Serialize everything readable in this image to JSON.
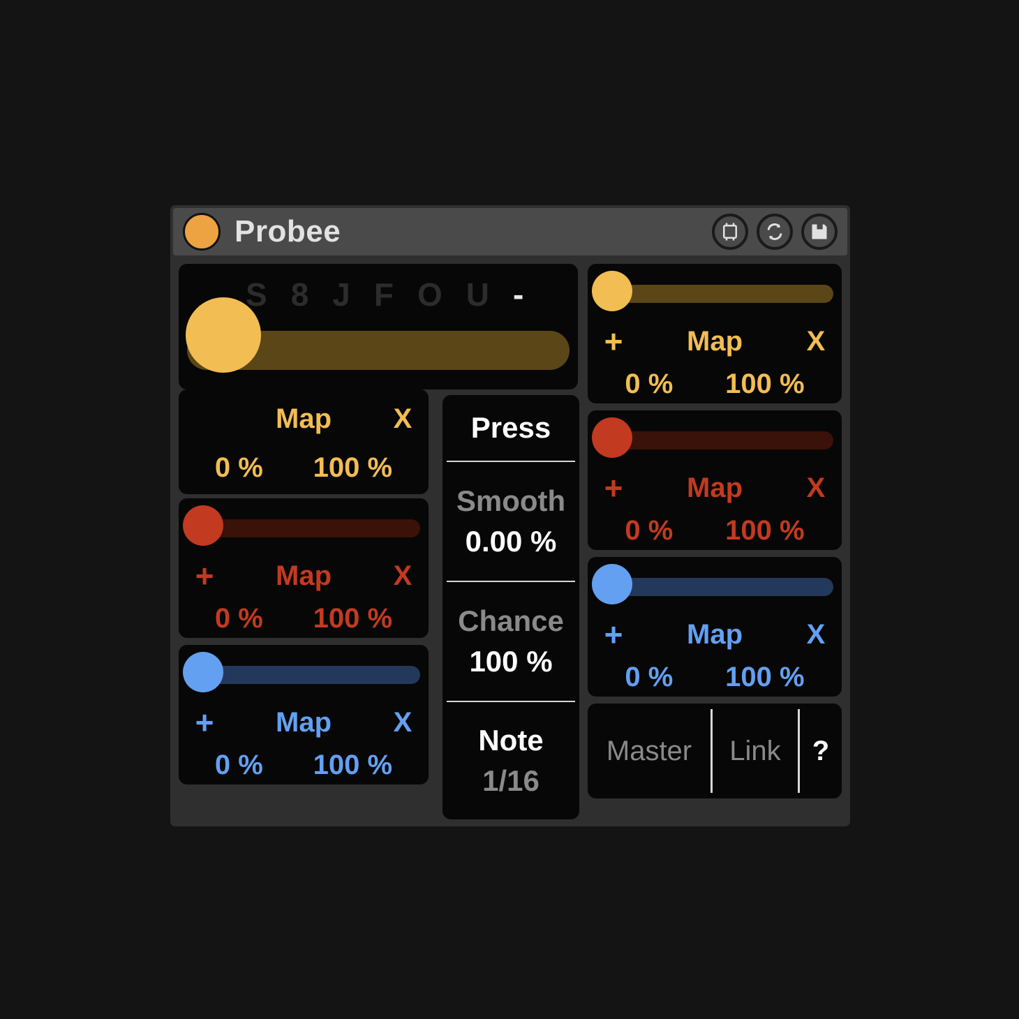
{
  "window": {
    "title": "Probee",
    "status_dot_color": "#eda341",
    "icons": [
      {
        "name": "device-chip-icon",
        "label": "chip"
      },
      {
        "name": "reload-icon",
        "label": "reload"
      },
      {
        "name": "save-icon",
        "label": "save"
      }
    ]
  },
  "colors": {
    "orange": "#f2bd52",
    "orange_track": "#5b4618",
    "red": "#c23a20",
    "red_track": "#3a1209",
    "blue": "#63a0f2",
    "blue_track": "#23395c",
    "panel_bg": "#070707",
    "frame_bg": "#2f2f2f",
    "titlebar_bg": "#4a4a4a",
    "ghost_text": "#2c2c2c"
  },
  "hero": {
    "ghost_chars": [
      "S",
      "8",
      "J",
      "F",
      "O",
      "U"
    ],
    "minus_label": "-",
    "value_percent": 0
  },
  "hero_map": {
    "label": "Map",
    "clear_label": "X",
    "min_value": "0 %",
    "max_value": "100 %"
  },
  "left_column": [
    {
      "id": "left-red",
      "color_key": "red",
      "add_label": "+",
      "label": "Map",
      "clear_label": "X",
      "min_value": "0 %",
      "max_value": "100 %",
      "value_percent": 0
    },
    {
      "id": "left-blue",
      "color_key": "blue",
      "add_label": "+",
      "label": "Map",
      "clear_label": "X",
      "min_value": "0 %",
      "max_value": "100 %",
      "value_percent": 0
    }
  ],
  "right_column": [
    {
      "id": "right-orange",
      "color_key": "orange",
      "add_label": "+",
      "label": "Map",
      "clear_label": "X",
      "min_value": "0 %",
      "max_value": "100 %",
      "value_percent": 0
    },
    {
      "id": "right-red",
      "color_key": "red",
      "add_label": "+",
      "label": "Map",
      "clear_label": "X",
      "min_value": "0 %",
      "max_value": "100 %",
      "value_percent": 0
    },
    {
      "id": "right-blue",
      "color_key": "blue",
      "add_label": "+",
      "label": "Map",
      "clear_label": "X",
      "min_value": "0 %",
      "max_value": "100 %",
      "value_percent": 0
    }
  ],
  "center": {
    "press": {
      "title": "Press"
    },
    "smooth": {
      "title": "Smooth",
      "value": "0.00 %"
    },
    "chance": {
      "title": "Chance",
      "value": "100 %"
    },
    "note": {
      "title": "Note",
      "value": "1/16"
    }
  },
  "footer": {
    "master_label": "Master",
    "link_label": "Link",
    "help_label": "?"
  }
}
